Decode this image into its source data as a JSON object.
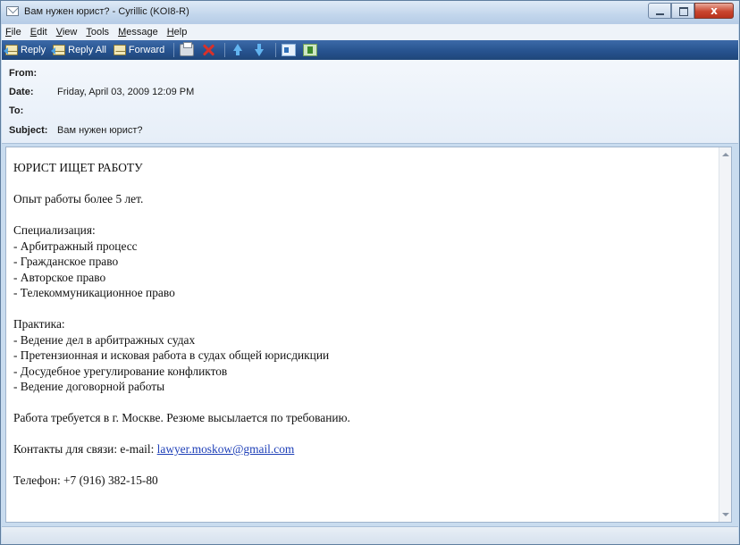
{
  "window": {
    "title": "Вам нужен юрист? - Cyrillic (KOI8-R)",
    "icon": "envelope-icon",
    "controls": [
      "minimize",
      "maximize",
      "close"
    ],
    "close_label": "x"
  },
  "menu": {
    "items": [
      {
        "accel": "F",
        "rest": "ile"
      },
      {
        "accel": "E",
        "rest": "dit"
      },
      {
        "accel": "V",
        "rest": "iew"
      },
      {
        "accel": "T",
        "rest": "ools"
      },
      {
        "accel": "M",
        "rest": "essage"
      },
      {
        "accel": "H",
        "rest": "elp"
      }
    ]
  },
  "toolbar": {
    "reply_label": "Reply",
    "reply_all_label": "Reply All",
    "forward_label": "Forward",
    "icons": [
      "print-icon",
      "delete-icon",
      "up-arrow-icon",
      "down-arrow-icon",
      "address-book-icon",
      "contacts-icon"
    ]
  },
  "header": {
    "from_label": "From:",
    "from_value": "",
    "date_label": "Date:",
    "date_value": "Friday, April 03, 2009 12:09 PM",
    "to_label": "To:",
    "to_value": "",
    "subject_label": "Subject:",
    "subject_value": "Вам нужен юрист?"
  },
  "message": {
    "heading": "ЮРИСТ ИЩЕТ РАБОТУ",
    "experience": "Опыт работы более 5 лет.",
    "specialization_title": "Специализация:",
    "specialization": [
      "- Арбитражный процесс",
      "- Гражданское право",
      "- Авторское право",
      "- Телекоммуникационное право"
    ],
    "practice_title": "Практика:",
    "practice": [
      "- Ведение дел в арбитражных судах",
      "- Претензионная и исковая работа в судах общей юрисдикции",
      "- Досудебное урегулирование конфликтов",
      "- Ведение договорной работы"
    ],
    "location": "Работа требуется в г. Москве. Резюме высылается по требованию.",
    "contacts_prefix": "Контакты для связи: e-mail: ",
    "email": "lawyer.moskow@gmail.com",
    "phone": "Телефон: +7 (916) 382-15-80"
  },
  "colors": {
    "toolbar_bg": "#27538f",
    "header_bg": "#eef3f9",
    "link": "#1f40b8",
    "close_button": "#c9462f"
  }
}
